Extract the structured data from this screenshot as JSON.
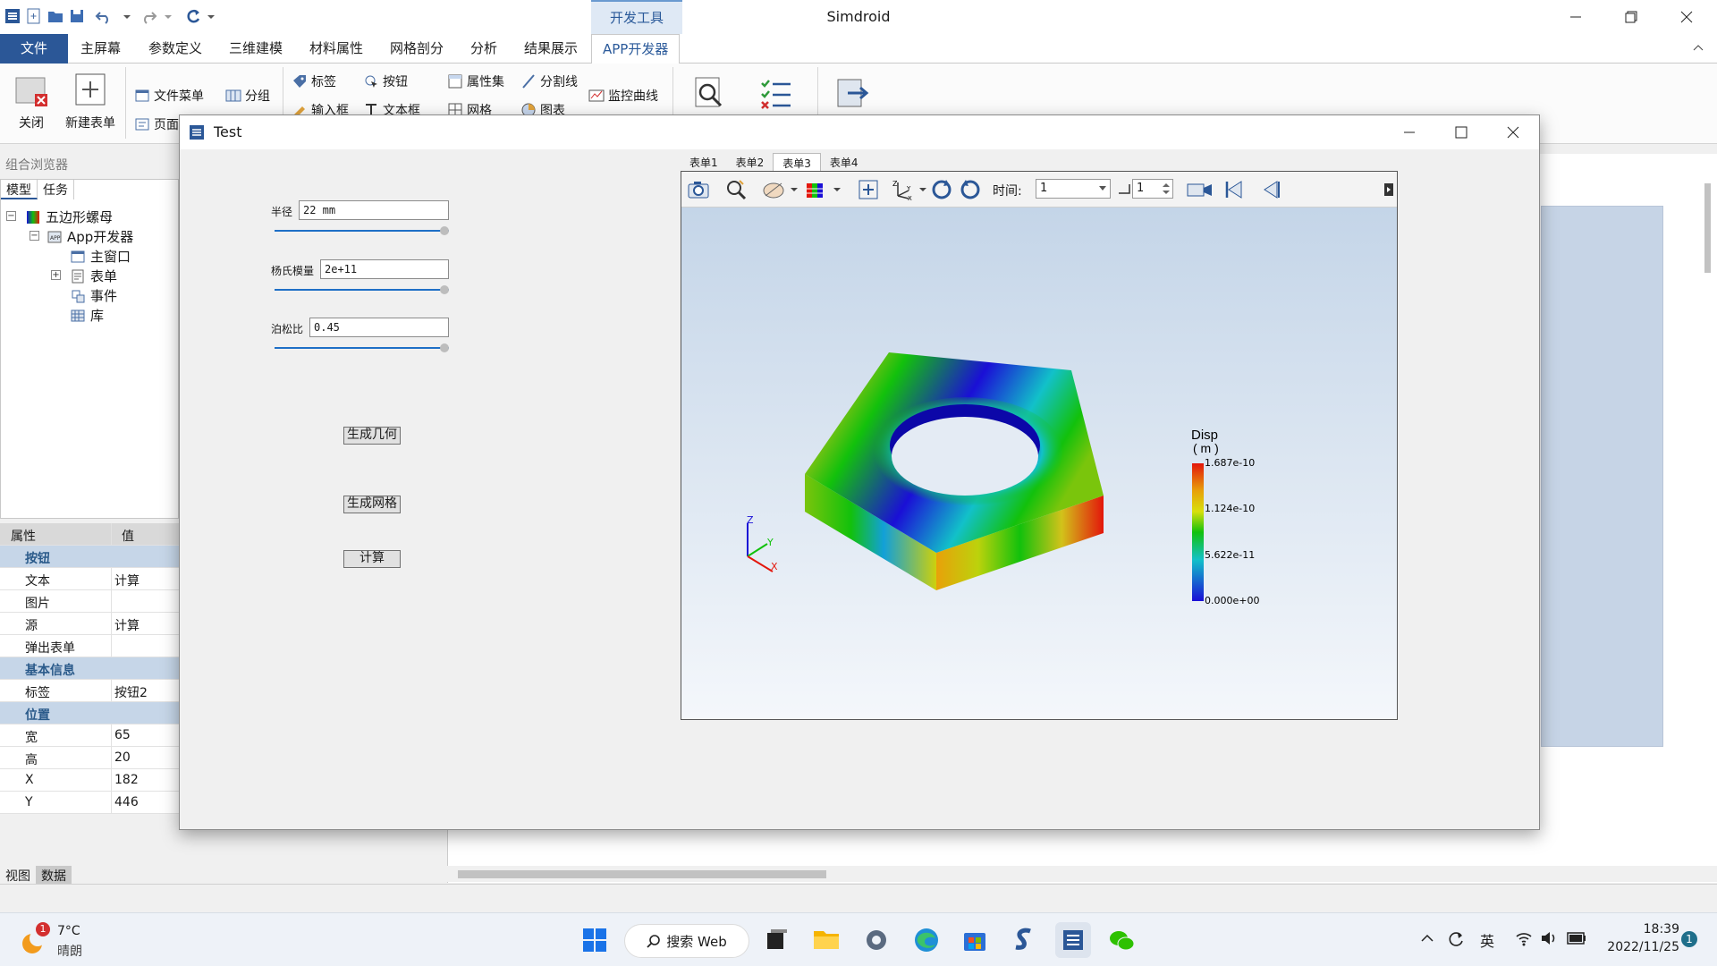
{
  "app": {
    "title": "Simdroid",
    "context_tab": "开发工具"
  },
  "menu": {
    "file": "文件",
    "tabs": [
      "主屏幕",
      "参数定义",
      "三维建模",
      "材料属性",
      "网格剖分",
      "分析",
      "结果展示",
      "APP开发器"
    ]
  },
  "ribbon": {
    "close": "关闭",
    "new_form": "新建表单",
    "file_menu": "文件菜单",
    "page": "页面",
    "group": "分组",
    "label": "标签",
    "input_box": "输入框",
    "button": "按钮",
    "textbox": "文本框",
    "property_set": "属性集",
    "mesh": "网格",
    "divider": "分割线",
    "chart": "图表",
    "monitor_curve": "监控曲线"
  },
  "left_panel": {
    "browser_title": "组合浏览器",
    "tabs": [
      "模型",
      "任务"
    ],
    "tree": {
      "root": "五边形螺母",
      "app": "App开发器",
      "children": [
        "主窗口",
        "表单",
        "事件",
        "库"
      ]
    },
    "bottom_tabs": [
      "视图",
      "数据"
    ]
  },
  "properties": {
    "header": {
      "key": "属性",
      "value": "值"
    },
    "rows": [
      {
        "type": "group",
        "key": "按钮"
      },
      {
        "key": "文本",
        "value": "计算"
      },
      {
        "key": "图片",
        "value": ""
      },
      {
        "key": "源",
        "value": "计算"
      },
      {
        "key": "弹出表单",
        "value": ""
      },
      {
        "type": "group",
        "key": "基本信息"
      },
      {
        "key": "标签",
        "value": "按钮2"
      },
      {
        "type": "group",
        "key": "位置"
      },
      {
        "key": "宽",
        "value": "65"
      },
      {
        "key": "高",
        "value": "20"
      },
      {
        "key": "X",
        "value": "182"
      },
      {
        "key": "Y",
        "value": "446"
      }
    ]
  },
  "dialog": {
    "title": "Test",
    "fields": [
      {
        "label": "半径",
        "value": "22 mm",
        "slider": 1.0
      },
      {
        "label": "杨氏模量",
        "value": "2e+11",
        "slider": 1.0
      },
      {
        "label": "泊松比",
        "value": "0.45",
        "slider": 1.0
      }
    ],
    "buttons": [
      "生成几何",
      "生成网格",
      "计算"
    ],
    "viewer": {
      "tabs": [
        "表单1",
        "表单2",
        "表单3",
        "表单4"
      ],
      "active_tab": "表单3",
      "time_label": "时间:",
      "time_value": "1",
      "step_value": "1",
      "legend": {
        "title": "Disp",
        "unit": "( m )",
        "ticks": [
          "1.687e-10",
          "1.124e-10",
          "5.622e-11",
          "0.000e+00"
        ]
      },
      "axes": {
        "z": "Z",
        "y": "Y",
        "x": "X"
      },
      "colors": {
        "max": "#e3160b",
        "mid": "#12c10c",
        "min": "#1a0fd6"
      }
    }
  },
  "taskbar": {
    "weather_temp": "7°C",
    "weather_desc": "晴朗",
    "weather_badge": "1",
    "search": "搜索 Web",
    "ime": "英",
    "time": "18:39",
    "date": "2022/11/25",
    "notif_count": "1"
  }
}
